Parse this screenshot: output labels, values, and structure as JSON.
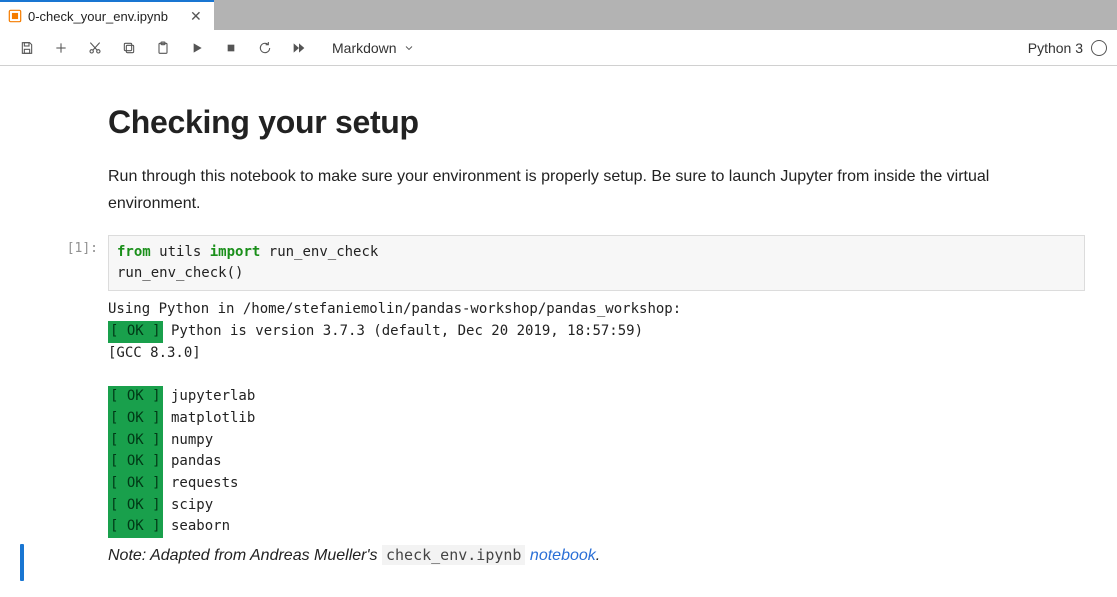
{
  "tab": {
    "title": "0-check_your_env.ipynb"
  },
  "toolbar": {
    "cell_type": "Markdown",
    "kernel": "Python 3"
  },
  "markdown": {
    "heading": "Checking your setup",
    "intro": "Run through this notebook to make sure your environment is properly setup. Be sure to launch Jupyter from inside the virtual environment."
  },
  "code_cell": {
    "prompt": "[1]:",
    "code": {
      "kw_from": "from",
      "mod": "utils",
      "kw_import": "import",
      "name": "run_env_check",
      "call": "run_env_check()"
    },
    "output": {
      "line1": "Using Python in /home/stefaniemolin/pandas-workshop/pandas_workshop:",
      "ok": "[ OK ]",
      "py_line_after": " Python is version 3.7.3 (default, Dec 20 2019, 18:57:59)",
      "gcc": "[GCC 8.3.0]",
      "packages": [
        "jupyterlab",
        "matplotlib",
        "numpy",
        "pandas",
        "requests",
        "scipy",
        "seaborn"
      ]
    }
  },
  "note": {
    "prefix": "Note: Adapted from Andreas Mueller's ",
    "code": "check_env.ipynb",
    "link": "notebook",
    "suffix": "."
  }
}
